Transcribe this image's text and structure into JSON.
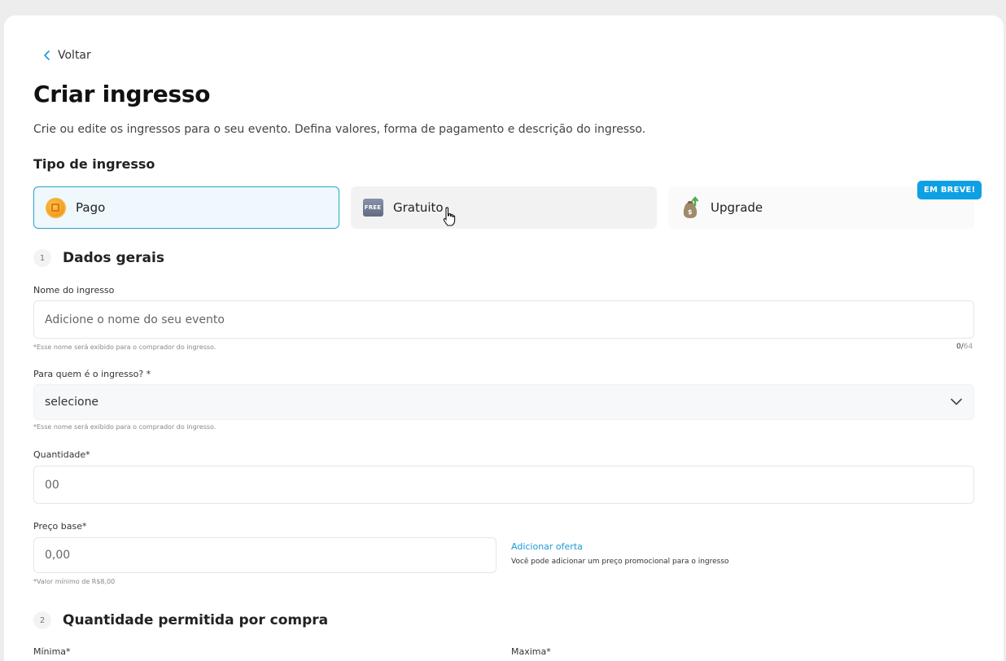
{
  "back": {
    "label": "Voltar"
  },
  "page": {
    "title": "Criar ingresso",
    "subtitle": "Crie ou edite os ingressos para o seu evento. Defina valores, forma de pagamento e descrição do ingresso."
  },
  "ticket_type": {
    "heading": "Tipo de ingresso",
    "options": [
      {
        "label": "Pago",
        "icon": "coin-icon",
        "selected": true
      },
      {
        "label": "Gratuito",
        "icon": "free-icon",
        "icon_text": "FREE",
        "selected": false
      },
      {
        "label": "Upgrade",
        "icon": "money-bag-icon",
        "selected": false,
        "badge": "EM BREVE!"
      }
    ]
  },
  "section1": {
    "number": "1",
    "title": "Dados gerais",
    "name_field": {
      "label": "Nome do ingresso",
      "placeholder": "Adicione o nome do seu evento",
      "hint": "*Esse nome será exibido para o comprador do ingresso.",
      "count": "0",
      "max": "64"
    },
    "audience_field": {
      "label": "Para quem é o ingresso? *",
      "value": "selecione",
      "hint": "*Esse nome será exibido para o comprador do ingresso."
    },
    "quantity_field": {
      "label": "Quantidade*",
      "placeholder": "00"
    },
    "price_field": {
      "label": "Preço base*",
      "placeholder": "0,00",
      "hint": "*Valor mínimo de R$8,00",
      "offer_link": "Adicionar oferta",
      "offer_helper": "Você pode adicionar um preço promocional para o ingresso"
    }
  },
  "section2": {
    "number": "2",
    "title": "Quantidade permitida por compra",
    "min_label": "Mínima*",
    "max_label": "Maxima*"
  },
  "colors": {
    "accent": "#0ea0e4",
    "selected_border": "#2aa3c8",
    "selected_bg": "#eef8fd"
  }
}
